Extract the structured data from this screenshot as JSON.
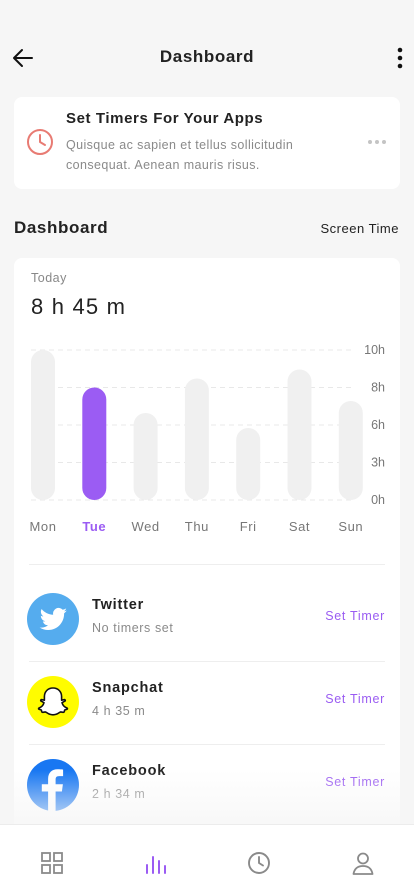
{
  "header": {
    "title": "Dashboard",
    "back_icon": "arrow-left-icon",
    "more_icon": "more-vertical-icon"
  },
  "timer_card": {
    "icon": "clock-icon",
    "title": "Set Timers For Your Apps",
    "description": "Quisque ac sapien et tellus sollicitudin consequat. Aenean mauris risus.",
    "more_icon": "more-horizontal-icon"
  },
  "section": {
    "title": "Dashboard",
    "link": "Screen Time"
  },
  "usage": {
    "period_label": "Today",
    "total": "8 h 45 m"
  },
  "chart_data": {
    "type": "bar",
    "categories": [
      "Mon",
      "Tue",
      "Wed",
      "Thu",
      "Fri",
      "Sat",
      "Sun"
    ],
    "values": [
      10,
      7.5,
      5.8,
      8.1,
      4.8,
      8.7,
      6.6
    ],
    "highlighted_category": "Tue",
    "y_ticks": [
      "10h",
      "8h",
      "6h",
      "3h",
      "0h"
    ],
    "ylim": [
      0,
      10
    ],
    "grid": true,
    "colors": {
      "active": "#9b5cf3",
      "inactive": "#f0f0f0",
      "active_label": "#9b5cf3",
      "label": "#777777"
    }
  },
  "apps": [
    {
      "name": "Twitter",
      "status": "No timers set",
      "action": "Set Timer",
      "icon": "twitter-icon",
      "color": "#55acee"
    },
    {
      "name": "Snapchat",
      "status": "4 h 35 m",
      "action": "Set Timer",
      "icon": "snapchat-icon",
      "color": "#fffc00"
    },
    {
      "name": "Facebook",
      "status": "2 h 34 m",
      "action": "Set Timer",
      "icon": "facebook-icon",
      "color": "#1877f2"
    }
  ],
  "bottom_nav": [
    {
      "icon": "grid-icon",
      "active": false
    },
    {
      "icon": "bar-chart-icon",
      "active": true
    },
    {
      "icon": "clock-icon",
      "active": false
    },
    {
      "icon": "user-icon",
      "active": false
    }
  ],
  "accent_color": "#9b5cf3"
}
